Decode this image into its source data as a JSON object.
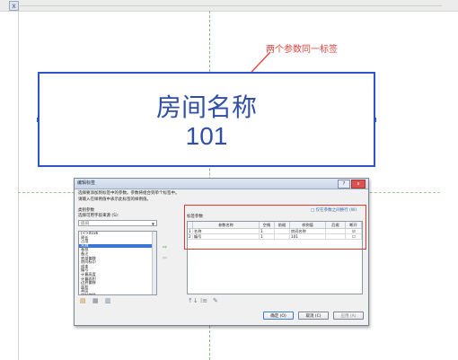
{
  "canvas": {
    "close_tab_icon": "close-icon",
    "annotation_text": "两个参数同一标签",
    "tag_line1": "房间名称",
    "tag_line2": "101"
  },
  "dialog": {
    "title": "编辑标签",
    "win_buttons": [
      "?",
      "x"
    ],
    "instruction1": "选择要添加到标签中的参数。参数将组合到单个标签中。",
    "instruction2": "请输入在样例值中表示此标签的样例值。",
    "category_label": "类别参数",
    "category_sub": "选择可用字段来源 (S):",
    "category_combo": "房间",
    "available_list": [
      "(<>0036",
      "周长",
      "占用",
      "名称",
      "基准",
      "备注",
      "底部偏移",
      "房间标识",
      "成本",
      "编号",
      "计算高度",
      "计算面积",
      "边界偏移",
      "面积",
      "高度",
      "限制偏移"
    ],
    "selected_index": 3,
    "label_params_title": "标签参数",
    "wrap_label": "□ 仅在参数之间换行 (W)",
    "columns": [
      "参数名称",
      "空格",
      "前缀",
      "样例值",
      "后缀",
      "断开"
    ],
    "rows": [
      {
        "idx": "1",
        "name": "名称",
        "space": "1",
        "prefix": "",
        "sample": "房间名称",
        "suffix": "",
        "break": "☑"
      },
      {
        "idx": "2",
        "name": "编号",
        "space": "1",
        "prefix": "",
        "sample": "101",
        "suffix": "",
        "break": "☐"
      }
    ],
    "btn_ok": "确定 (O)",
    "btn_cancel": "取消 (C)",
    "btn_apply": "应用 (A)"
  }
}
